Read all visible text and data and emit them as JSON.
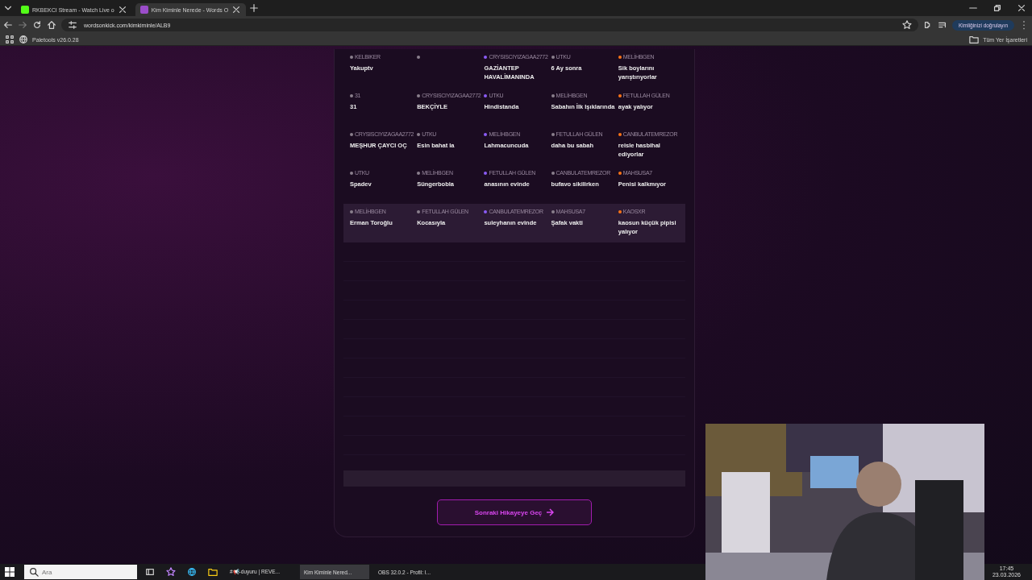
{
  "browser": {
    "tabs": [
      {
        "title": "RKBEKCI Stream - Watch Live o",
        "selected": false
      },
      {
        "title": "Kim Kiminle Nerede - Words O",
        "selected": true
      }
    ],
    "url": "wordsonkick.com/kimkiminle/ALB9",
    "profile_button": "Kimliğinizi doğrulayın",
    "bookmarks": [
      "Paletools v26.0.28"
    ],
    "all_bookmarks": "Tüm Yer İşaretleri"
  },
  "grid": {
    "rows": [
      {
        "highlighted": false,
        "cells": [
          {
            "player": "KELBIKER",
            "color": "#8a7f8c",
            "answer": "Yakuptv"
          },
          {
            "color": "#8a7f8c"
          },
          {
            "player": "CRYSISCIYIZAGAA2772",
            "color": "#8b5cf6",
            "answer": "GAZİANTEP HAVALİMANINDA"
          },
          {
            "player": "UTKU",
            "color": "#8a7f8c",
            "answer": "6 Ay sonra"
          },
          {
            "player": "MELİHBGEN",
            "color": "#f97316",
            "answer": "Sik boylarını yarıştırıyorlar"
          }
        ]
      },
      {
        "highlighted": false,
        "cells": [
          {
            "player": "31",
            "color": "#8a7f8c",
            "answer": "31"
          },
          {
            "player": "CRYSISCIYIZAGAA2772",
            "color": "#8a7f8c",
            "answer": "BEKÇİYLE"
          },
          {
            "player": "UTKU",
            "color": "#8b5cf6",
            "answer": "Hindistanda"
          },
          {
            "player": "MELİHBGEN",
            "color": "#8a7f8c",
            "answer": "Sabahın İlk Işıklarında"
          },
          {
            "player": "FETULLAH GÜLEN",
            "color": "#f97316",
            "answer": "ayak yalıyor"
          }
        ]
      },
      {
        "highlighted": false,
        "cells": [
          {
            "player": "CRYSISCIYIZAGAA2772",
            "color": "#8a7f8c",
            "answer": "MEŞHUR ÇAYCI OÇ"
          },
          {
            "player": "UTKU",
            "color": "#8a7f8c",
            "answer": "Esin bahat la"
          },
          {
            "player": "MELİHBGEN",
            "color": "#8b5cf6",
            "answer": "Lahmacuncuda"
          },
          {
            "player": "FETULLAH GÜLEN",
            "color": "#8a7f8c",
            "answer": "daha bu sabah"
          },
          {
            "player": "CANBULATEMREZOR",
            "color": "#f97316",
            "answer": "reisle hasbihal ediyorlar"
          }
        ]
      },
      {
        "highlighted": false,
        "cells": [
          {
            "player": "UTKU",
            "color": "#8a7f8c",
            "answer": "Spadev"
          },
          {
            "player": "MELİHBGEN",
            "color": "#8a7f8c",
            "answer": "Süngerbobla"
          },
          {
            "player": "FETULLAH GÜLEN",
            "color": "#8b5cf6",
            "answer": "anasının evinde"
          },
          {
            "player": "CANBULATEMREZOR",
            "color": "#8a7f8c",
            "answer": "bufavo sikilirken"
          },
          {
            "player": "MAHSUSA7",
            "color": "#f97316",
            "answer": "Penisi kalkmıyor"
          }
        ]
      },
      {
        "highlighted": true,
        "cells": [
          {
            "player": "MELİHBGEN",
            "color": "#8a7f8c",
            "answer": "Erman Toroğlu"
          },
          {
            "player": "FETULLAH GÜLEN",
            "color": "#8a7f8c",
            "answer": "Kocasıyla"
          },
          {
            "player": "CANBULATEMREZOR",
            "color": "#8b5cf6",
            "answer": "suleyhanın evinde"
          },
          {
            "player": "MAHSUSA7",
            "color": "#8a7f8c",
            "answer": "Şafak vakti"
          },
          {
            "player": "KAOSXR",
            "color": "#f97316",
            "answer": "kaosun küçük pipisi yalıyor"
          }
        ]
      }
    ]
  },
  "next_button": "Sonraki Hikayeye Geç",
  "taskbar": {
    "search_placeholder": "Ara",
    "apps": [
      {
        "label": "#📢-duyuru | REVE...",
        "selected": false
      },
      {
        "label": "Kim Kiminle Nered...",
        "selected": true
      },
      {
        "label": "OBS 32.0.2 - Profil: I...",
        "selected": false
      }
    ],
    "time": "17:45",
    "date": "23.03.2026"
  }
}
